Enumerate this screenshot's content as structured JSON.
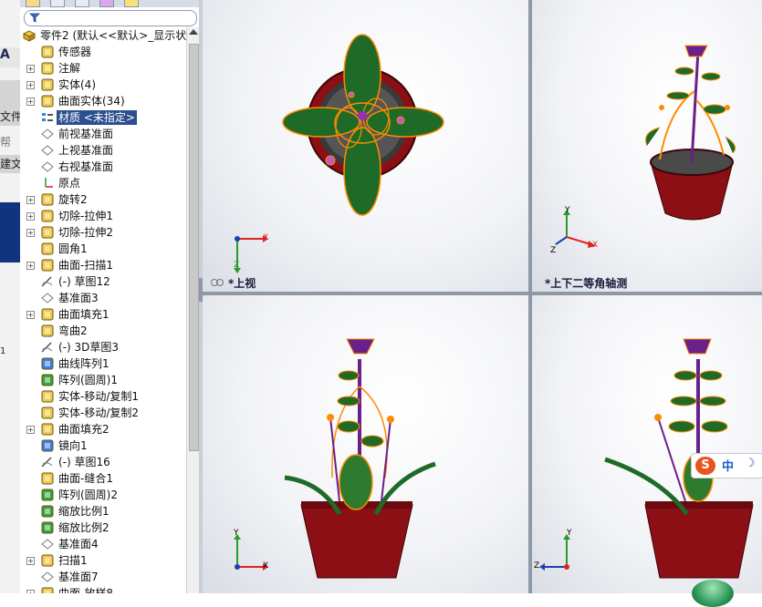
{
  "left_strip": {
    "items": [
      "",
      "文件",
      "帮",
      "建文"
    ],
    "footer_fragment": "1"
  },
  "filter": {
    "icon": "funnel-icon"
  },
  "tree": {
    "root": "零件2 (默认<<默认>_显示状",
    "items": [
      {
        "label": "传感器",
        "icon": "sensor-icon",
        "expander": false
      },
      {
        "label": "注解",
        "icon": "annotation-icon",
        "expander": true
      },
      {
        "label": "实体(4)",
        "icon": "solid-body-icon",
        "expander": true
      },
      {
        "label": "曲面实体(34)",
        "icon": "surface-body-icon",
        "expander": true
      },
      {
        "label": "材质 <未指定>",
        "icon": "material-icon",
        "expander": false,
        "selected": true
      },
      {
        "label": "前视基准面",
        "icon": "plane-icon",
        "expander": false
      },
      {
        "label": "上视基准面",
        "icon": "plane-icon",
        "expander": false
      },
      {
        "label": "右视基准面",
        "icon": "plane-icon",
        "expander": false
      },
      {
        "label": "原点",
        "icon": "origin-icon",
        "expander": false
      },
      {
        "label": "旋转2",
        "icon": "revolve-icon",
        "expander": true
      },
      {
        "label": "切除-拉伸1",
        "icon": "cut-extrude-icon",
        "expander": true
      },
      {
        "label": "切除-拉伸2",
        "icon": "cut-extrude-icon",
        "expander": true
      },
      {
        "label": "圆角1",
        "icon": "fillet-icon",
        "expander": false
      },
      {
        "label": "曲面-扫描1",
        "icon": "surface-sweep-icon",
        "expander": true
      },
      {
        "label": "(-) 草图12",
        "icon": "sketch-icon",
        "expander": false
      },
      {
        "label": "基准面3",
        "icon": "plane-icon",
        "expander": false
      },
      {
        "label": "曲面填充1",
        "icon": "surface-fill-icon",
        "expander": true
      },
      {
        "label": "弯曲2",
        "icon": "flex-icon",
        "expander": false
      },
      {
        "label": "(-) 3D草图3",
        "icon": "3d-sketch-icon",
        "expander": false
      },
      {
        "label": "曲线阵列1",
        "icon": "curve-pattern-icon",
        "expander": false
      },
      {
        "label": "阵列(圆周)1",
        "icon": "circular-pattern-icon",
        "expander": false
      },
      {
        "label": "实体-移动/复制1",
        "icon": "move-copy-icon",
        "expander": false
      },
      {
        "label": "实体-移动/复制2",
        "icon": "move-copy-icon",
        "expander": false
      },
      {
        "label": "曲面填充2",
        "icon": "surface-fill-icon",
        "expander": true
      },
      {
        "label": "镜向1",
        "icon": "mirror-icon",
        "expander": false
      },
      {
        "label": "(-) 草图16",
        "icon": "sketch-icon",
        "expander": false
      },
      {
        "label": "曲面-缝合1",
        "icon": "knit-icon",
        "expander": false
      },
      {
        "label": "阵列(圆周)2",
        "icon": "circular-pattern-icon",
        "expander": false
      },
      {
        "label": "缩放比例1",
        "icon": "scale-icon",
        "expander": false
      },
      {
        "label": "缩放比例2",
        "icon": "scale-icon",
        "expander": false
      },
      {
        "label": "基准面4",
        "icon": "plane-icon",
        "expander": false
      },
      {
        "label": "扫描1",
        "icon": "sweep-icon",
        "expander": true
      },
      {
        "label": "基准面7",
        "icon": "plane-icon",
        "expander": false
      },
      {
        "label": "曲面-放样8",
        "icon": "loft-icon",
        "expander": true
      }
    ]
  },
  "viewports": {
    "top": {
      "label": "*上视"
    },
    "iso": {
      "label": "*上下二等角轴测"
    }
  },
  "axes": {
    "x": "X",
    "y": "Y",
    "z": "Z"
  },
  "ime": {
    "logo": "S",
    "mode": "中",
    "moon": "☽"
  },
  "colors": {
    "pot": "#8b0f14",
    "leaf": "#1f6a26",
    "stem": "#6b1f8a",
    "edge_highlight": "#ff8c00",
    "selection": "#2c4f8f"
  }
}
